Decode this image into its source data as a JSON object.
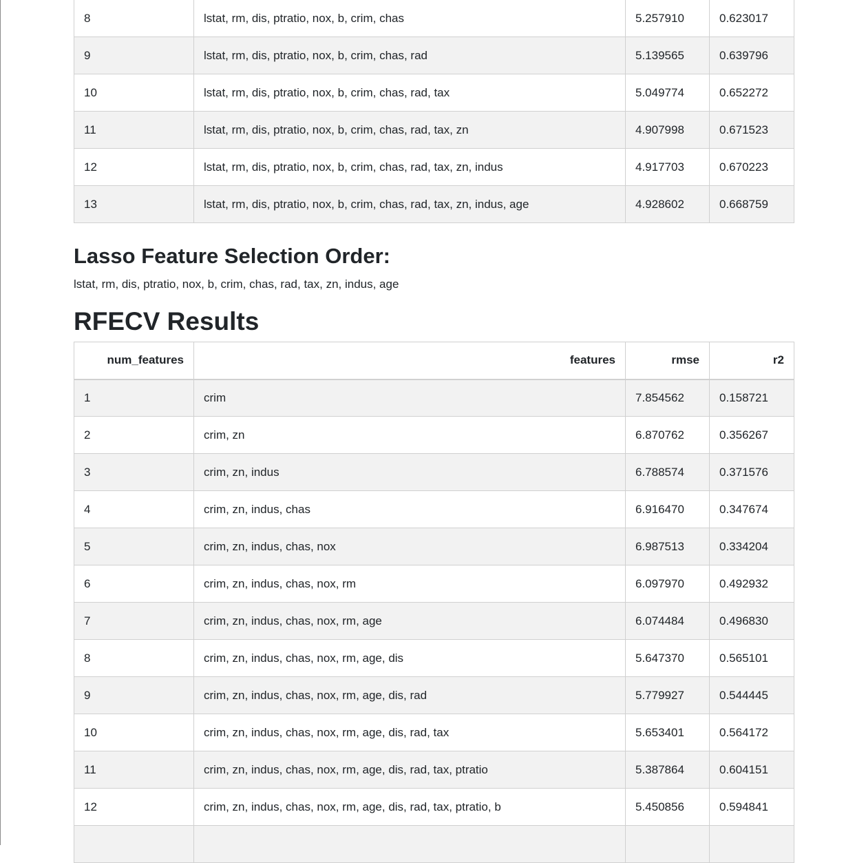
{
  "top_table": {
    "rows": [
      {
        "num_features": "8",
        "features": "lstat, rm, dis, ptratio, nox, b, crim, chas",
        "rmse": "5.257910",
        "r2": "0.623017"
      },
      {
        "num_features": "9",
        "features": "lstat, rm, dis, ptratio, nox, b, crim, chas, rad",
        "rmse": "5.139565",
        "r2": "0.639796"
      },
      {
        "num_features": "10",
        "features": "lstat, rm, dis, ptratio, nox, b, crim, chas, rad, tax",
        "rmse": "5.049774",
        "r2": "0.652272"
      },
      {
        "num_features": "11",
        "features": "lstat, rm, dis, ptratio, nox, b, crim, chas, rad, tax, zn",
        "rmse": "4.907998",
        "r2": "0.671523"
      },
      {
        "num_features": "12",
        "features": "lstat, rm, dis, ptratio, nox, b, crim, chas, rad, tax, zn, indus",
        "rmse": "4.917703",
        "r2": "0.670223"
      },
      {
        "num_features": "13",
        "features": "lstat, rm, dis, ptratio, nox, b, crim, chas, rad, tax, zn, indus, age",
        "rmse": "4.928602",
        "r2": "0.668759"
      }
    ]
  },
  "lasso": {
    "heading": "Lasso Feature Selection Order:",
    "order": "lstat, rm, dis, ptratio, nox, b, crim, chas, rad, tax, zn, indus, age"
  },
  "rfecv": {
    "heading": "RFECV Results",
    "columns": [
      "num_features",
      "features",
      "rmse",
      "r2"
    ],
    "rows": [
      {
        "num_features": "1",
        "features": "crim",
        "rmse": "7.854562",
        "r2": "0.158721"
      },
      {
        "num_features": "2",
        "features": "crim, zn",
        "rmse": "6.870762",
        "r2": "0.356267"
      },
      {
        "num_features": "3",
        "features": "crim, zn, indus",
        "rmse": "6.788574",
        "r2": "0.371576"
      },
      {
        "num_features": "4",
        "features": "crim, zn, indus, chas",
        "rmse": "6.916470",
        "r2": "0.347674"
      },
      {
        "num_features": "5",
        "features": "crim, zn, indus, chas, nox",
        "rmse": "6.987513",
        "r2": "0.334204"
      },
      {
        "num_features": "6",
        "features": "crim, zn, indus, chas, nox, rm",
        "rmse": "6.097970",
        "r2": "0.492932"
      },
      {
        "num_features": "7",
        "features": "crim, zn, indus, chas, nox, rm, age",
        "rmse": "6.074484",
        "r2": "0.496830"
      },
      {
        "num_features": "8",
        "features": "crim, zn, indus, chas, nox, rm, age, dis",
        "rmse": "5.647370",
        "r2": "0.565101"
      },
      {
        "num_features": "9",
        "features": "crim, zn, indus, chas, nox, rm, age, dis, rad",
        "rmse": "5.779927",
        "r2": "0.544445"
      },
      {
        "num_features": "10",
        "features": "crim, zn, indus, chas, nox, rm, age, dis, rad, tax",
        "rmse": "5.653401",
        "r2": "0.564172"
      },
      {
        "num_features": "11",
        "features": "crim, zn, indus, chas, nox, rm, age, dis, rad, tax, ptratio",
        "rmse": "5.387864",
        "r2": "0.604151"
      },
      {
        "num_features": "12",
        "features": "crim, zn, indus, chas, nox, rm, age, dis, rad, tax, ptratio, b",
        "rmse": "5.450856",
        "r2": "0.594841"
      },
      {
        "num_features": "",
        "features": "",
        "rmse": "",
        "r2": ""
      }
    ]
  }
}
